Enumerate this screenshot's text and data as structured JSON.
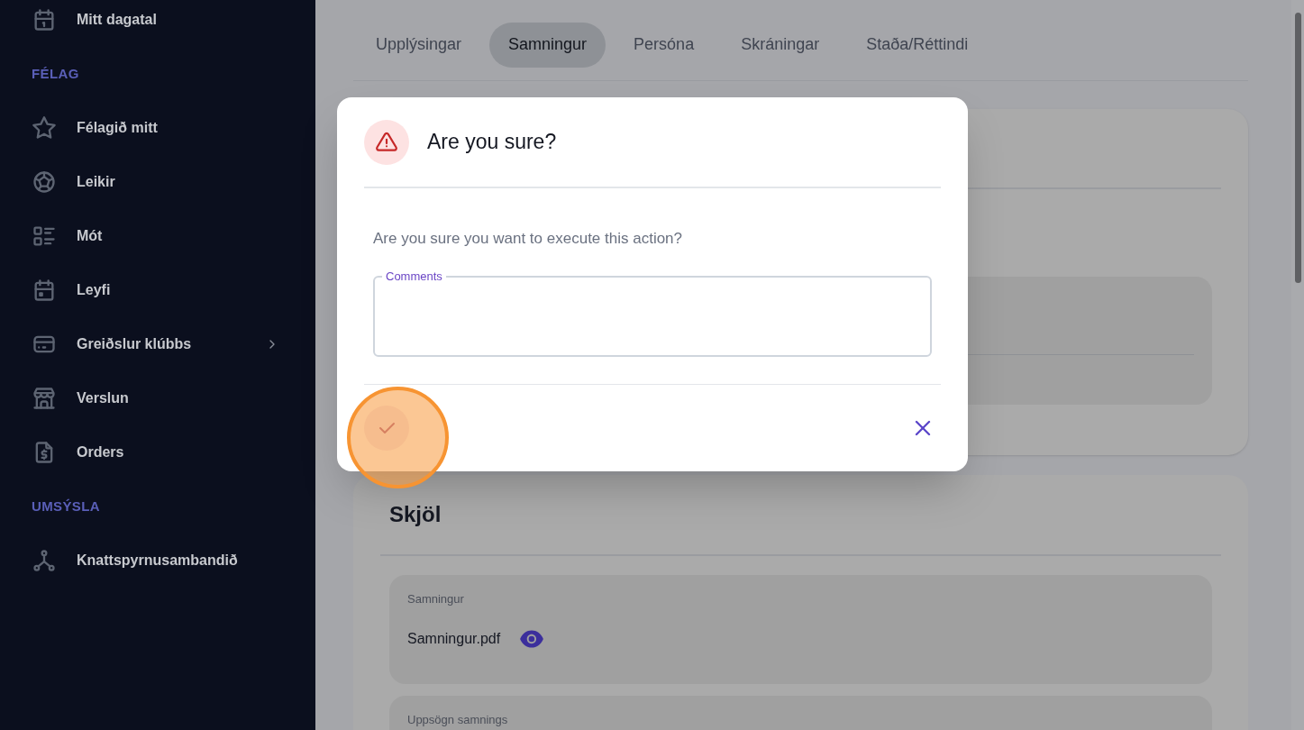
{
  "sidebar": {
    "entries": [
      {
        "kind": "item",
        "label": "Mitt dagatal",
        "expandable": false
      },
      {
        "kind": "heading",
        "label": "FÉLAG"
      },
      {
        "kind": "item",
        "label": "Félagið mitt",
        "expandable": false
      },
      {
        "kind": "item",
        "label": "Leikir",
        "expandable": false
      },
      {
        "kind": "item",
        "label": "Mót",
        "expandable": false
      },
      {
        "kind": "item",
        "label": "Leyfi",
        "expandable": false
      },
      {
        "kind": "item",
        "label": "Greiðslur klúbbs",
        "expandable": true
      },
      {
        "kind": "item",
        "label": "Verslun",
        "expandable": false
      },
      {
        "kind": "item",
        "label": "Orders",
        "expandable": false
      },
      {
        "kind": "heading",
        "label": "UMSÝSLA"
      },
      {
        "kind": "item",
        "label": "Knattspyrnusambandið",
        "expandable": false
      }
    ]
  },
  "tabs": [
    {
      "label": "Upplýsingar",
      "selected": false
    },
    {
      "label": "Samningur",
      "selected": true
    },
    {
      "label": "Persóna",
      "selected": false
    },
    {
      "label": "Skráningar",
      "selected": false
    },
    {
      "label": "Staða/Réttindi",
      "selected": false
    }
  ],
  "documents": {
    "title": "Skjöl",
    "items": [
      {
        "label": "Samningur",
        "file": "Samningur.pdf"
      },
      {
        "label": "Uppsögn samnings"
      }
    ]
  },
  "dialog": {
    "title": "Are you sure?",
    "message": "Are you sure you want to execute this action?",
    "comments": {
      "label": "Comments"
    }
  }
}
